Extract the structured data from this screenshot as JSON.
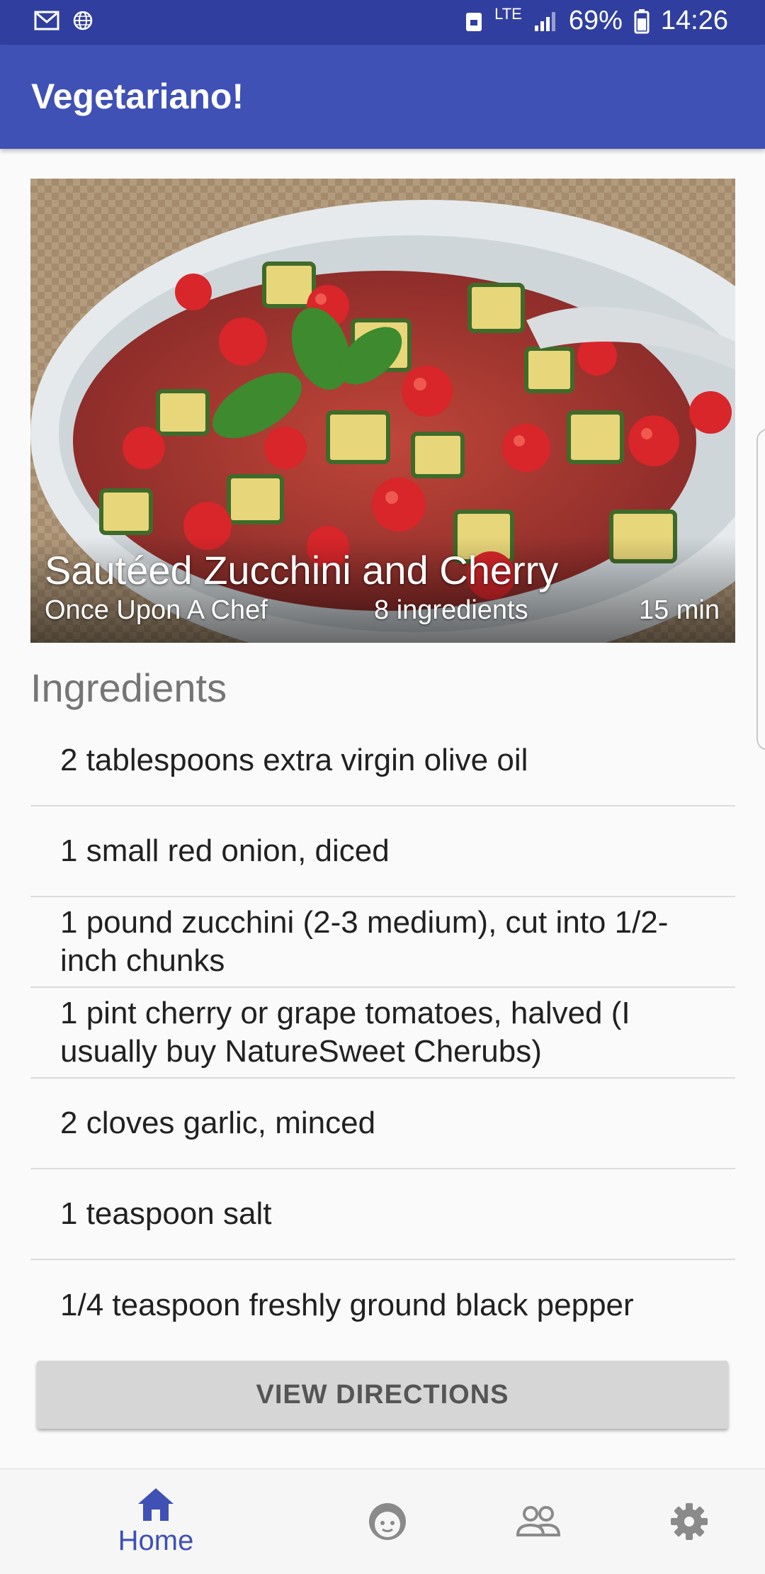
{
  "status_bar": {
    "left_icons": [
      "mail-icon",
      "globe-icon"
    ],
    "network": "LTE",
    "battery": "69%",
    "time": "14:26",
    "background": "#303f9f"
  },
  "app_bar": {
    "title": "Vegetariano!",
    "background": "#3f51b5"
  },
  "recipe": {
    "title": "Sautéed Zucchini and Cherry",
    "source": "Once Upon A Chef",
    "ingredient_count": "8 ingredients",
    "time": "15 min"
  },
  "ingredients_section": {
    "title": "Ingredients",
    "items": [
      "2 tablespoons extra virgin olive oil",
      "1 small red onion, diced",
      "1 pound zucchini (2-3 medium), cut into 1/2-inch chunks",
      "1 pint cherry or grape tomatoes, halved (I usually buy NatureSweet Cherubs)",
      "2 cloves garlic, minced",
      "1 teaspoon salt",
      "1/4 teaspoon freshly ground black pepper"
    ]
  },
  "actions": {
    "view_directions": "VIEW DIRECTIONS"
  },
  "bottom_nav": {
    "items": [
      {
        "icon": "home-icon",
        "label": "Home",
        "selected": true
      },
      {
        "icon": "face-icon",
        "label": "",
        "selected": false
      },
      {
        "icon": "people-icon",
        "label": "",
        "selected": false
      },
      {
        "icon": "gear-icon",
        "label": "",
        "selected": false
      }
    ],
    "accent": "#3f51b5",
    "inactive": "#8a8a8a"
  }
}
